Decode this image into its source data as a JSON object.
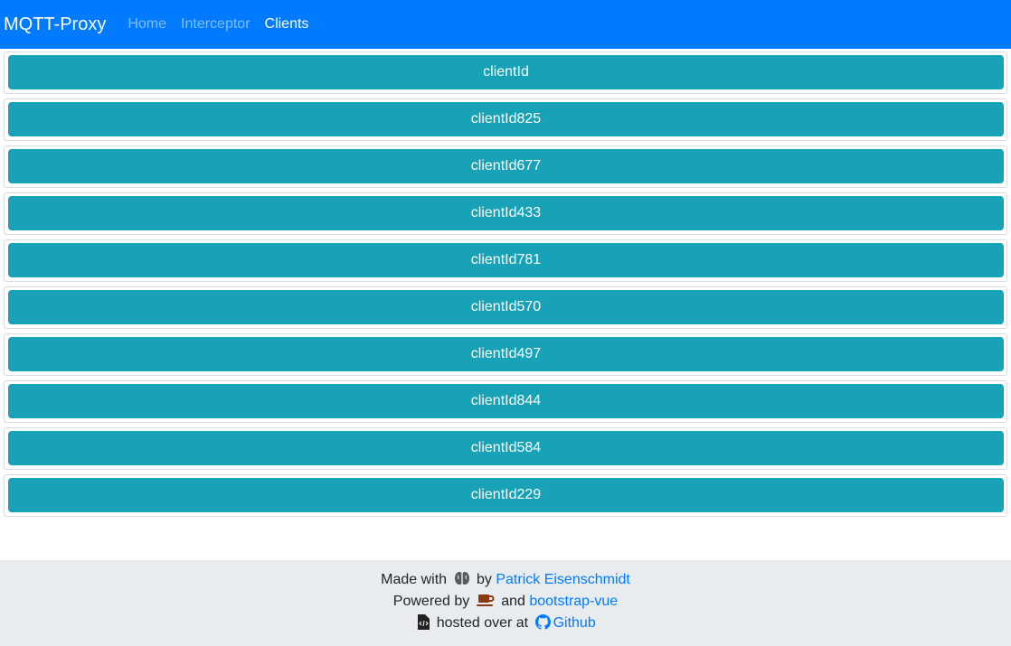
{
  "navbar": {
    "brand": "MQTT-Proxy",
    "links": [
      {
        "label": "Home"
      },
      {
        "label": "Interceptor"
      },
      {
        "label": "Clients"
      }
    ],
    "active": "Clients"
  },
  "clients": [
    "clientId",
    "clientId825",
    "clientId677",
    "clientId433",
    "clientId781",
    "clientId570",
    "clientId497",
    "clientId844",
    "clientId584",
    "clientId229"
  ],
  "footer": {
    "line1": {
      "prefix": "Made with",
      "icon": "brain-icon",
      "middle": "by",
      "link": "Patrick Eisenschmidt"
    },
    "line2": {
      "prefix": "Powered by",
      "icon": "coffee-icon",
      "middle": "and",
      "link": "bootstrap-vue"
    },
    "line3": {
      "icon": "file-code-icon",
      "text": "hosted over at",
      "link_icon": "github-icon",
      "link": "Github"
    }
  },
  "colors": {
    "navbar": "#007bff",
    "client_button": "#17a2b8",
    "footer_bg": "#e9ecef",
    "link": "#007bff"
  }
}
